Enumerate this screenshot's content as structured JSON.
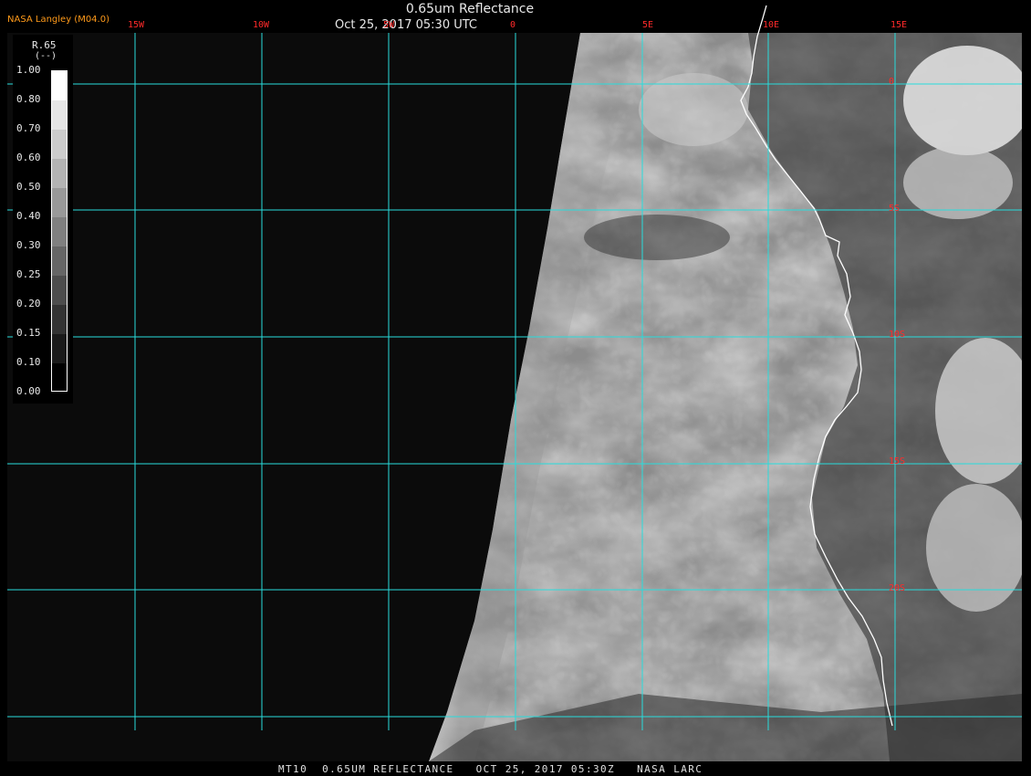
{
  "header": {
    "title": "0.65um Reflectance",
    "datetime": "Oct 25, 2017 05:30 UTC",
    "org": "NASA Langley (M04.0)"
  },
  "footer": {
    "text": "MT10  0.65UM REFLECTANCE   OCT 25, 2017 05:30Z   NASA LARC"
  },
  "legend": {
    "variable": "R.65",
    "units": "(--)",
    "ticks": [
      "1.00",
      "0.80",
      "0.70",
      "0.60",
      "0.50",
      "0.40",
      "0.30",
      "0.25",
      "0.20",
      "0.15",
      "0.10",
      "0.00"
    ]
  },
  "grid": {
    "lon_labels": [
      "15W",
      "10W",
      "5W",
      "0",
      "5E",
      "10E",
      "15E"
    ],
    "lat_labels": [
      "0",
      "5S",
      "10S",
      "15S",
      "20S"
    ]
  },
  "colors": {
    "grid": "#28dcdc",
    "coast": "#ffffff",
    "labels": "#ff2a2a",
    "org": "#ff9a1a"
  }
}
